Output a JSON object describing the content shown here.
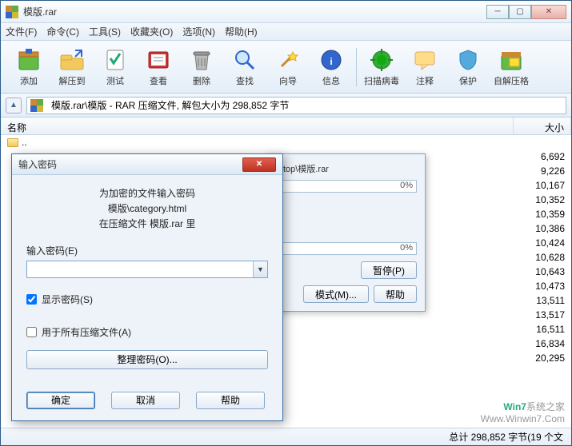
{
  "window": {
    "title": "模版.rar"
  },
  "menu": {
    "file": "文件(F)",
    "cmd": "命令(C)",
    "tool": "工具(S)",
    "fav": "收藏夹(O)",
    "opt": "选项(N)",
    "help": "帮助(H)"
  },
  "toolbar": {
    "add": "添加",
    "extract": "解压到",
    "test": "测试",
    "view": "查看",
    "delete": "删除",
    "find": "查找",
    "wizard": "向导",
    "info": "信息",
    "scan": "扫描病毒",
    "comment": "注释",
    "protect": "保护",
    "sfx": "自解压格"
  },
  "address": {
    "path": "模版.rar\\模版 - RAR 压缩文件, 解包大小为 298,852 字节"
  },
  "columns": {
    "name": "名称",
    "size": "大小"
  },
  "rows": {
    "up": "..",
    "sizes": [
      "6,692",
      "9,226",
      "10,167",
      "10,352",
      "10,359",
      "10,386",
      "10,424",
      "10,628",
      "10,643",
      "10,473",
      "13,511",
      "13,517",
      "16,511",
      "16,834",
      "20,295"
    ]
  },
  "status": {
    "total": "总计 298,852 字节(19 个文"
  },
  "progress": {
    "file": "sktop\\模版.rar",
    "pct1": "0%",
    "pct2": "0%",
    "pause": "暂停(P)",
    "mode": "模式(M)...",
    "help": "帮助"
  },
  "pw": {
    "title": "输入密码",
    "line1": "为加密的文件输入密码",
    "line2": "模版\\category.html",
    "line3": "在压缩文件 模版.rar 里",
    "label": "输入密码(E)",
    "show": "显示密码(S)",
    "all": "用于所有压缩文件(A)",
    "manage": "整理密码(O)...",
    "ok": "确定",
    "cancel": "取消",
    "help": "帮助"
  },
  "watermark": {
    "l1a": "Win7",
    "l1b": "系统之家",
    "l2": "Www.Winwin7.Com"
  }
}
